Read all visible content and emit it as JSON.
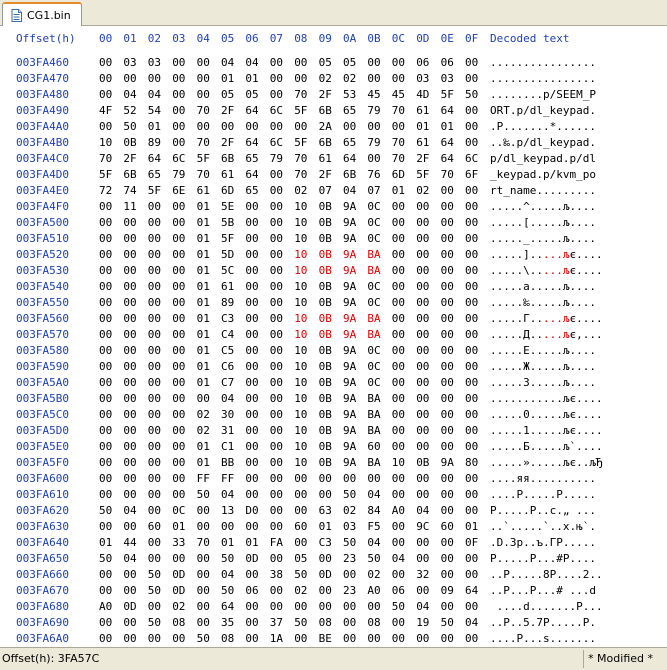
{
  "tab": {
    "title": "CG1.bin"
  },
  "header": {
    "offset_label": "Offset(h)",
    "columns": [
      "00",
      "01",
      "02",
      "03",
      "04",
      "05",
      "06",
      "07",
      "08",
      "09",
      "0A",
      "0B",
      "0C",
      "0D",
      "0E",
      "0F"
    ],
    "decoded_label": "Decoded text"
  },
  "rows": [
    {
      "offset": "003FA460",
      "hex": [
        "00",
        "03",
        "03",
        "00",
        "00",
        "04",
        "04",
        "00",
        "00",
        "05",
        "05",
        "00",
        "00",
        "06",
        "06",
        "00"
      ],
      "text": "................"
    },
    {
      "offset": "003FA470",
      "hex": [
        "00",
        "00",
        "00",
        "00",
        "00",
        "01",
        "01",
        "00",
        "00",
        "02",
        "02",
        "00",
        "00",
        "03",
        "03",
        "00"
      ],
      "text": "................"
    },
    {
      "offset": "003FA480",
      "hex": [
        "00",
        "04",
        "04",
        "00",
        "00",
        "05",
        "05",
        "00",
        "70",
        "2F",
        "53",
        "45",
        "45",
        "4D",
        "5F",
        "50"
      ],
      "text": "........p/SEEM_P"
    },
    {
      "offset": "003FA490",
      "hex": [
        "4F",
        "52",
        "54",
        "00",
        "70",
        "2F",
        "64",
        "6C",
        "5F",
        "6B",
        "65",
        "79",
        "70",
        "61",
        "64",
        "00"
      ],
      "text": "ORT.p/dl_keypad."
    },
    {
      "offset": "003FA4A0",
      "hex": [
        "00",
        "50",
        "01",
        "00",
        "00",
        "00",
        "00",
        "00",
        "00",
        "2A",
        "00",
        "00",
        "00",
        "01",
        "01",
        "00"
      ],
      "text": ".P.......*......"
    },
    {
      "offset": "003FA4B0",
      "hex": [
        "10",
        "0B",
        "89",
        "00",
        "70",
        "2F",
        "64",
        "6C",
        "5F",
        "6B",
        "65",
        "79",
        "70",
        "61",
        "64",
        "00"
      ],
      "text": "..‰.p/dl_keypad."
    },
    {
      "offset": "003FA4C0",
      "hex": [
        "70",
        "2F",
        "64",
        "6C",
        "5F",
        "6B",
        "65",
        "79",
        "70",
        "61",
        "64",
        "00",
        "70",
        "2F",
        "64",
        "6C"
      ],
      "text": "p/dl_keypad.p/dl"
    },
    {
      "offset": "003FA4D0",
      "hex": [
        "5F",
        "6B",
        "65",
        "79",
        "70",
        "61",
        "64",
        "00",
        "70",
        "2F",
        "6B",
        "76",
        "6D",
        "5F",
        "70",
        "6F"
      ],
      "text": "_keypad.p/kvm_po"
    },
    {
      "offset": "003FA4E0",
      "hex": [
        "72",
        "74",
        "5F",
        "6E",
        "61",
        "6D",
        "65",
        "00",
        "02",
        "07",
        "04",
        "07",
        "01",
        "02",
        "00",
        "00"
      ],
      "text": "rt_name........."
    },
    {
      "offset": "003FA4F0",
      "hex": [
        "00",
        "11",
        "00",
        "00",
        "01",
        "5E",
        "00",
        "00",
        "10",
        "0B",
        "9A",
        "0C",
        "00",
        "00",
        "00",
        "00"
      ],
      "text": ".....^.....љ...."
    },
    {
      "offset": "003FA500",
      "hex": [
        "00",
        "00",
        "00",
        "00",
        "01",
        "5B",
        "00",
        "00",
        "10",
        "0B",
        "9A",
        "0C",
        "00",
        "00",
        "00",
        "00"
      ],
      "text": ".....[.....љ...."
    },
    {
      "offset": "003FA510",
      "hex": [
        "00",
        "00",
        "00",
        "00",
        "01",
        "5F",
        "00",
        "00",
        "10",
        "0B",
        "9A",
        "0C",
        "00",
        "00",
        "00",
        "00"
      ],
      "text": "....._.....љ...."
    },
    {
      "offset": "003FA520",
      "hex": [
        "00",
        "00",
        "00",
        "00",
        "01",
        "5D",
        "00",
        "00",
        "10",
        "0B",
        "9A",
        "BA",
        "00",
        "00",
        "00",
        "00"
      ],
      "text": ".....].....љє....",
      "hi": [
        8,
        9,
        10,
        11
      ],
      "thi": [
        8,
        11
      ]
    },
    {
      "offset": "003FA530",
      "hex": [
        "00",
        "00",
        "00",
        "00",
        "01",
        "5C",
        "00",
        "00",
        "10",
        "0B",
        "9A",
        "BA",
        "00",
        "00",
        "00",
        "00"
      ],
      "text": ".....\\.....љє....",
      "hi": [
        8,
        9,
        10,
        11
      ],
      "thi": [
        8,
        11
      ]
    },
    {
      "offset": "003FA540",
      "hex": [
        "00",
        "00",
        "00",
        "00",
        "01",
        "61",
        "00",
        "00",
        "10",
        "0B",
        "9A",
        "0C",
        "00",
        "00",
        "00",
        "00"
      ],
      "text": ".....a.....љ...."
    },
    {
      "offset": "003FA550",
      "hex": [
        "00",
        "00",
        "00",
        "00",
        "01",
        "89",
        "00",
        "00",
        "10",
        "0B",
        "9A",
        "0C",
        "00",
        "00",
        "00",
        "00"
      ],
      "text": ".....‰.....љ...."
    },
    {
      "offset": "003FA560",
      "hex": [
        "00",
        "00",
        "00",
        "00",
        "01",
        "C3",
        "00",
        "00",
        "10",
        "0B",
        "9A",
        "BA",
        "00",
        "00",
        "00",
        "00"
      ],
      "text": ".....Г.....љє....",
      "hi": [
        8,
        9,
        10,
        11
      ],
      "thi": [
        8,
        11
      ]
    },
    {
      "offset": "003FA570",
      "hex": [
        "00",
        "00",
        "00",
        "00",
        "01",
        "C4",
        "00",
        "00",
        "10",
        "0B",
        "9A",
        "BA",
        "00",
        "00",
        "00",
        "00"
      ],
      "text": ".....Д.....љє,...",
      "hi": [
        8,
        9,
        10,
        11
      ],
      "thi": [
        8,
        11
      ]
    },
    {
      "offset": "003FA580",
      "hex": [
        "00",
        "00",
        "00",
        "00",
        "01",
        "C5",
        "00",
        "00",
        "10",
        "0B",
        "9A",
        "0C",
        "00",
        "00",
        "00",
        "00"
      ],
      "text": ".....Е.....љ...."
    },
    {
      "offset": "003FA590",
      "hex": [
        "00",
        "00",
        "00",
        "00",
        "01",
        "C6",
        "00",
        "00",
        "10",
        "0B",
        "9A",
        "0C",
        "00",
        "00",
        "00",
        "00"
      ],
      "text": ".....Ж.....љ...."
    },
    {
      "offset": "003FA5A0",
      "hex": [
        "00",
        "00",
        "00",
        "00",
        "01",
        "C7",
        "00",
        "00",
        "10",
        "0B",
        "9A",
        "0C",
        "00",
        "00",
        "00",
        "00"
      ],
      "text": ".....З.....љ...."
    },
    {
      "offset": "003FA5B0",
      "hex": [
        "00",
        "00",
        "00",
        "00",
        "00",
        "04",
        "00",
        "00",
        "10",
        "0B",
        "9A",
        "BA",
        "00",
        "00",
        "00",
        "00"
      ],
      "text": "...........љє...."
    },
    {
      "offset": "003FA5C0",
      "hex": [
        "00",
        "00",
        "00",
        "00",
        "02",
        "30",
        "00",
        "00",
        "10",
        "0B",
        "9A",
        "BA",
        "00",
        "00",
        "00",
        "00"
      ],
      "text": ".....0.....љє...."
    },
    {
      "offset": "003FA5D0",
      "hex": [
        "00",
        "00",
        "00",
        "00",
        "02",
        "31",
        "00",
        "00",
        "10",
        "0B",
        "9A",
        "BA",
        "00",
        "00",
        "00",
        "00"
      ],
      "text": ".....1.....љє...."
    },
    {
      "offset": "003FA5E0",
      "hex": [
        "00",
        "00",
        "00",
        "00",
        "01",
        "C1",
        "00",
        "00",
        "10",
        "0B",
        "9A",
        "60",
        "00",
        "00",
        "00",
        "00"
      ],
      "text": ".....Б.....љ`...."
    },
    {
      "offset": "003FA5F0",
      "hex": [
        "00",
        "00",
        "00",
        "00",
        "01",
        "BB",
        "00",
        "00",
        "10",
        "0B",
        "9A",
        "BA",
        "10",
        "0B",
        "9A",
        "80"
      ],
      "text": ".....».....љє..љЂ"
    },
    {
      "offset": "003FA600",
      "hex": [
        "00",
        "00",
        "00",
        "00",
        "FF",
        "FF",
        "00",
        "00",
        "00",
        "00",
        "00",
        "00",
        "00",
        "00",
        "00",
        "00"
      ],
      "text": "....яя.........."
    },
    {
      "offset": "003FA610",
      "hex": [
        "00",
        "00",
        "00",
        "00",
        "50",
        "04",
        "00",
        "00",
        "00",
        "00",
        "50",
        "04",
        "00",
        "00",
        "00",
        "00"
      ],
      "text": "....P.....P....."
    },
    {
      "offset": "003FA620",
      "hex": [
        "50",
        "04",
        "00",
        "0C",
        "00",
        "13",
        "D0",
        "00",
        "00",
        "63",
        "02",
        "84",
        "A0",
        "04",
        "00",
        "00"
      ],
      "text": "P.....Р..c.„ ..."
    },
    {
      "offset": "003FA630",
      "hex": [
        "00",
        "00",
        "60",
        "01",
        "00",
        "00",
        "00",
        "00",
        "60",
        "01",
        "03",
        "F5",
        "00",
        "9C",
        "60",
        "01"
      ],
      "text": "..`.....`..х.њ`."
    },
    {
      "offset": "003FA640",
      "hex": [
        "01",
        "44",
        "00",
        "33",
        "70",
        "01",
        "01",
        "FA",
        "00",
        "C3",
        "50",
        "04",
        "00",
        "00",
        "00",
        "0F"
      ],
      "text": ".D.3p..ъ.ГP....."
    },
    {
      "offset": "003FA650",
      "hex": [
        "50",
        "04",
        "00",
        "00",
        "00",
        "50",
        "0D",
        "00",
        "05",
        "00",
        "23",
        "50",
        "04",
        "00",
        "00",
        "00"
      ],
      "text": "P.....P...#P...."
    },
    {
      "offset": "003FA660",
      "hex": [
        "00",
        "00",
        "50",
        "0D",
        "00",
        "04",
        "00",
        "38",
        "50",
        "0D",
        "00",
        "02",
        "00",
        "32",
        "00",
        "00"
      ],
      "text": "..P.....8P....2.."
    },
    {
      "offset": "003FA670",
      "hex": [
        "00",
        "00",
        "50",
        "0D",
        "00",
        "50",
        "06",
        "00",
        "02",
        "00",
        "23",
        "A0",
        "06",
        "00",
        "09",
        "64"
      ],
      "text": "..P...P...# ...d"
    },
    {
      "offset": "003FA680",
      "hex": [
        "A0",
        "0D",
        "00",
        "02",
        "00",
        "64",
        "00",
        "00",
        "00",
        "00",
        "00",
        "00",
        "50",
        "04",
        "00",
        "00"
      ],
      "text": " ....d.......P..."
    },
    {
      "offset": "003FA690",
      "hex": [
        "00",
        "00",
        "50",
        "08",
        "00",
        "35",
        "00",
        "37",
        "50",
        "08",
        "00",
        "08",
        "00",
        "19",
        "50",
        "04"
      ],
      "text": "..P..5.7P.....P."
    },
    {
      "offset": "003FA6A0",
      "hex": [
        "00",
        "00",
        "00",
        "00",
        "50",
        "08",
        "00",
        "1A",
        "00",
        "BE",
        "00",
        "00",
        "00",
        "00",
        "00",
        "00"
      ],
      "text": "....P...s......."
    }
  ],
  "status": {
    "offset": "Offset(h): 3FA57C",
    "modified": "* Modified *"
  },
  "colors": {
    "offset_blue": "#1f3fb0",
    "highlight_red": "#e00000",
    "tab_accent": "#e68b2c"
  },
  "icons": {
    "tab": "file-icon"
  }
}
